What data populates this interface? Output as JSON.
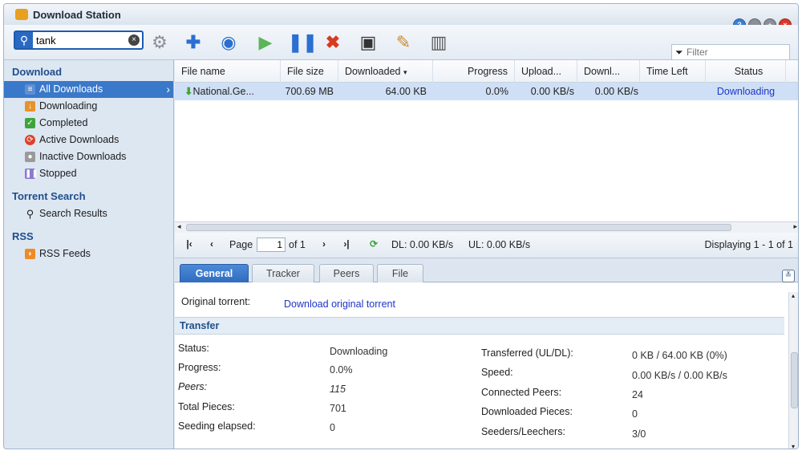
{
  "window": {
    "title": "Download Station"
  },
  "toolbar": {
    "search_value": "tank",
    "filter_placeholder": "Filter",
    "buttons": [
      "settings",
      "add",
      "add-url",
      "resume",
      "pause",
      "delete",
      "save",
      "edit",
      "clear"
    ]
  },
  "sidebar": {
    "download_header": "Download",
    "items": [
      {
        "label": "All Downloads",
        "active": true
      },
      {
        "label": "Downloading"
      },
      {
        "label": "Completed"
      },
      {
        "label": "Active Downloads"
      },
      {
        "label": "Inactive Downloads"
      },
      {
        "label": "Stopped"
      }
    ],
    "torrent_header": "Torrent Search",
    "search_results": "Search Results",
    "rss_header": "RSS",
    "rss_feeds": "RSS Feeds"
  },
  "grid": {
    "columns": [
      "File name",
      "File size",
      "Downloaded",
      "Progress",
      "Upload...",
      "Downl...",
      "Time Left",
      "Status"
    ],
    "row": {
      "name": "National.Ge...",
      "size": "700.69 MB",
      "downloaded": "64.00 KB",
      "progress": "0.0%",
      "upload": "0.00 KB/s",
      "download": "0.00 KB/s",
      "time_left": "",
      "status": "Downloading"
    }
  },
  "pager": {
    "page_label": "Page",
    "page_value": "1",
    "of_label": "of 1",
    "dl": "DL: 0.00 KB/s",
    "ul": "UL: 0.00 KB/s",
    "display": "Displaying 1 - 1 of 1"
  },
  "tabs": [
    "General",
    "Tracker",
    "Peers",
    "File"
  ],
  "detail": {
    "original_label": "Original torrent:",
    "original_link": "Download original torrent",
    "section": "Transfer",
    "left": [
      {
        "label": "Status:",
        "value": "Downloading"
      },
      {
        "label": "Progress:",
        "value": "0.0%"
      },
      {
        "label": "Peers:",
        "value": "115"
      },
      {
        "label": "Total Pieces:",
        "value": "701"
      },
      {
        "label": "Seeding elapsed:",
        "value": "0"
      }
    ],
    "right": [
      {
        "label": "Transferred (UL/DL):",
        "value": "0 KB / 64.00 KB (0%)"
      },
      {
        "label": "Speed:",
        "value": "0.00 KB/s / 0.00 KB/s"
      },
      {
        "label": "Connected Peers:",
        "value": "24"
      },
      {
        "label": "Downloaded Pieces:",
        "value": "0"
      },
      {
        "label": "Seeders/Leechers:",
        "value": "3/0"
      }
    ]
  },
  "colors": {
    "accent": "#3a78c9",
    "link": "#1d35c8",
    "header": "#1f4e8c"
  }
}
